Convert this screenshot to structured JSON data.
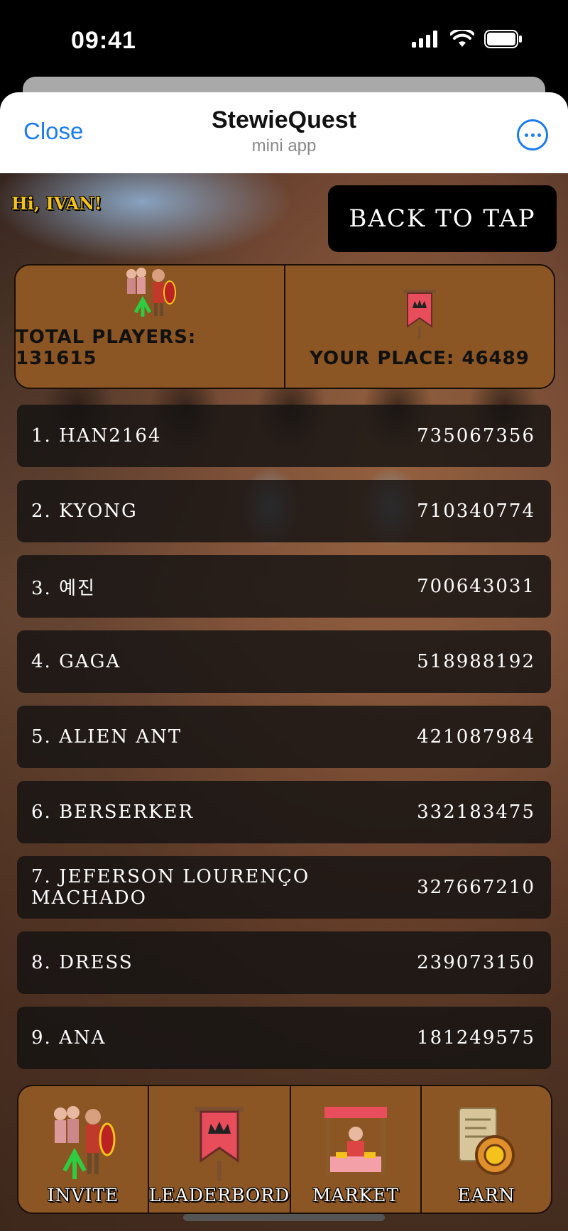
{
  "status_bar": {
    "time": "09:41"
  },
  "header": {
    "close_label": "Close",
    "title": "StewieQuest",
    "subtitle": "mini app"
  },
  "greeting": "Hi, IVAN!",
  "back_button": "BACK TO TAP",
  "stats": {
    "total_players_label": "TOTAL PLAYERS: 131615",
    "your_place_label": "YOUR PLACE: 46489"
  },
  "leaderboard": [
    {
      "name": "1. HAN2164",
      "score": "735067356"
    },
    {
      "name": "2. KYONG",
      "score": "710340774"
    },
    {
      "name": "3. 예진",
      "score": "700643031"
    },
    {
      "name": "4. GAGA",
      "score": "518988192"
    },
    {
      "name": "5. ALIEN ANT",
      "score": "421087984"
    },
    {
      "name": "6. BERSERKER",
      "score": "332183475"
    },
    {
      "name": "7. JEFERSON LOURENÇO MACHADO",
      "score": "327667210"
    },
    {
      "name": "8. DRESS",
      "score": "239073150"
    },
    {
      "name": "9. ANA",
      "score": "181249575"
    }
  ],
  "nav": [
    {
      "label": "INVITE",
      "icon": "soldiers-icon"
    },
    {
      "label": "LEADERBORD",
      "icon": "banner-icon"
    },
    {
      "label": "MARKET",
      "icon": "market-stall-icon"
    },
    {
      "label": "EARN",
      "icon": "scroll-coin-icon"
    }
  ],
  "colors": {
    "panel": "#8b5524",
    "accent_blue": "#1b7cf0",
    "greeting": "#f4c21a"
  }
}
